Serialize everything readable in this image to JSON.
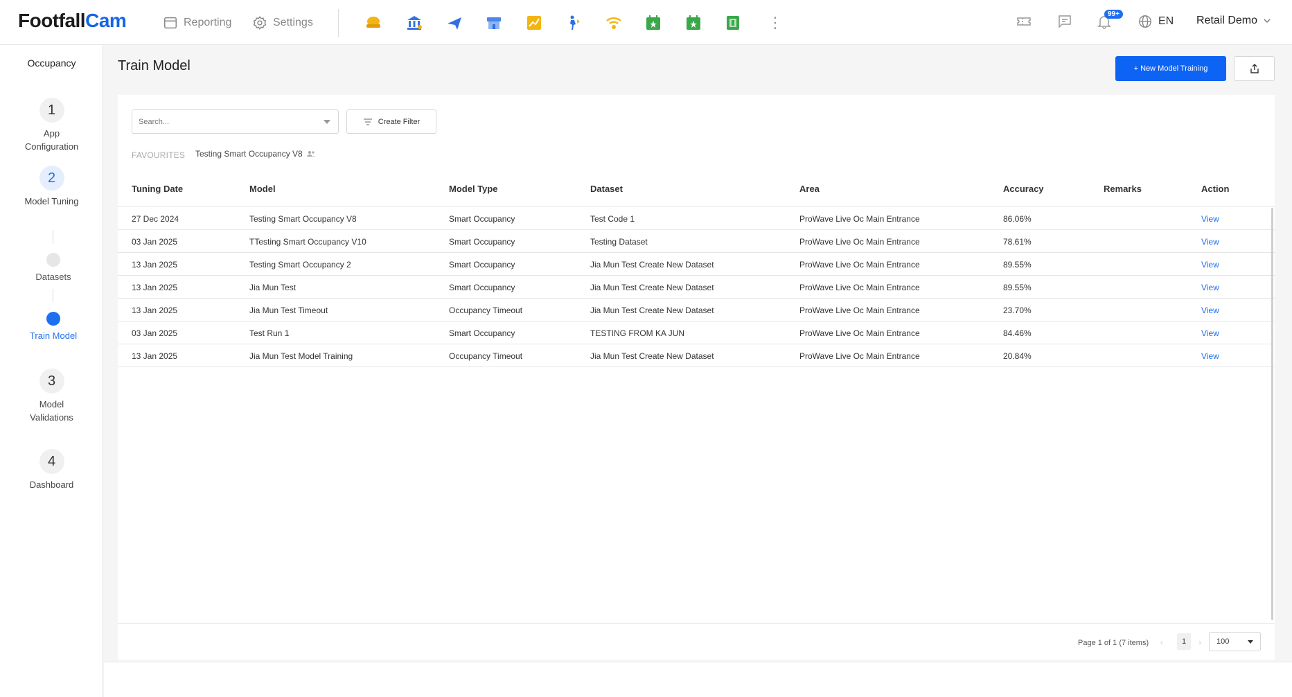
{
  "brand": {
    "part1": "Footfall",
    "part2": "Cam"
  },
  "nav": {
    "reporting": "Reporting",
    "settings": "Settings"
  },
  "header_right": {
    "notification_badge": "99+",
    "language": "EN",
    "account": "Retail Demo"
  },
  "sidebar": {
    "title": "Occupancy",
    "steps": [
      {
        "num": "1",
        "label": "App Configuration"
      },
      {
        "num": "2",
        "label": "Model Tuning"
      },
      {
        "num": "3",
        "label": "Model Validations"
      },
      {
        "num": "4",
        "label": "Dashboard"
      }
    ],
    "substeps": [
      {
        "label": "Datasets"
      },
      {
        "label": "Train Model"
      }
    ]
  },
  "page": {
    "title": "Train Model",
    "new_button": "+ New Model Training"
  },
  "filters": {
    "search_placeholder": "Search...",
    "create_filter": "Create Filter",
    "favourites_label": "FAVOURITES",
    "favourite_item": "Testing Smart Occupancy V8"
  },
  "table": {
    "columns": [
      "Tuning Date",
      "Model",
      "Model Type",
      "Dataset",
      "Area",
      "Accuracy",
      "Remarks",
      "Action"
    ],
    "rows": [
      [
        "27 Dec 2024",
        "Testing Smart Occupancy V8",
        "Smart Occupancy",
        "Test Code 1",
        "ProWave Live Oc Main Entrance",
        "86.06%",
        "",
        "View"
      ],
      [
        "03 Jan 2025",
        "TTesting Smart Occupancy V10",
        "Smart Occupancy",
        "Testing Dataset",
        "ProWave Live Oc Main Entrance",
        "78.61%",
        "",
        "View"
      ],
      [
        "13 Jan 2025",
        "Testing Smart Occupancy 2",
        "Smart Occupancy",
        "Jia Mun Test Create New Dataset",
        "ProWave Live Oc Main Entrance",
        "89.55%",
        "",
        "View"
      ],
      [
        "13 Jan 2025",
        "Jia Mun Test",
        "Smart Occupancy",
        "Jia Mun Test Create New Dataset",
        "ProWave Live Oc Main Entrance",
        "89.55%",
        "",
        "View"
      ],
      [
        "13 Jan 2025",
        "Jia Mun Test Timeout",
        "Occupancy Timeout",
        "Jia Mun Test Create New Dataset",
        "ProWave Live Oc Main Entrance",
        "23.70%",
        "",
        "View"
      ],
      [
        "03 Jan 2025",
        "Test Run 1",
        "Smart Occupancy",
        "TESTING FROM KA JUN",
        "ProWave Live Oc Main Entrance",
        "84.46%",
        "",
        "View"
      ],
      [
        "13 Jan 2025",
        "Jia Mun Test Model Training",
        "Occupancy Timeout",
        "Jia Mun Test Create New Dataset",
        "ProWave Live Oc Main Entrance",
        "20.84%",
        "",
        "View"
      ]
    ]
  },
  "pagination": {
    "info": "Page 1 of 1 (7 items)",
    "prev": "‹",
    "current_page": "1",
    "next": "›",
    "page_size": "100"
  }
}
